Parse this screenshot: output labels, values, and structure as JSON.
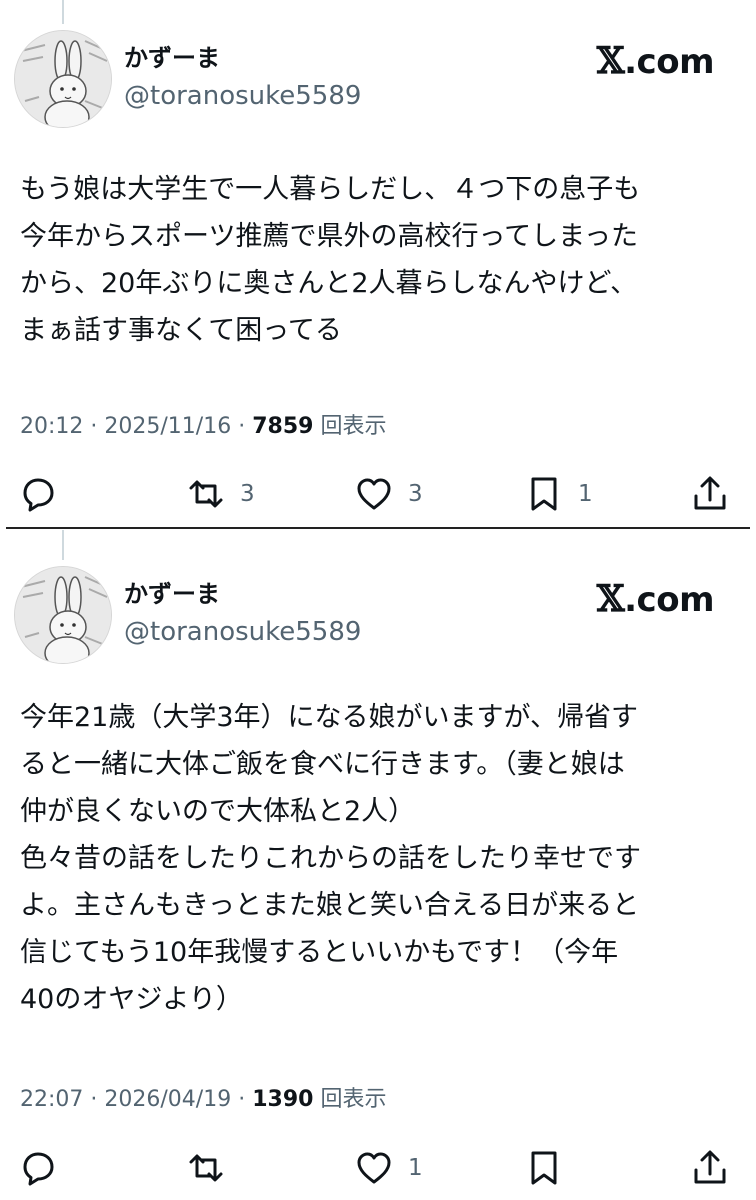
{
  "tweets": [
    {
      "display_name": "かずーま",
      "handle": "@toranosuke5589",
      "brand": ".com",
      "text": "もう娘は大学生で一人暮らしだし、４つ下の息子も\n今年からスポーツ推薦で県外の高校行ってしまった\nから、20年ぶりに奥さんと2人暮らしなんやけど、\nまぁ話す事なくて困ってる",
      "time": "20:12",
      "date": "2025/11/16",
      "views": "7859",
      "views_label": "回表示",
      "retweets": "3",
      "likes": "3",
      "bookmarks": "1"
    },
    {
      "display_name": "かずーま",
      "handle": "@toranosuke5589",
      "brand": ".com",
      "text": "今年21歳（大学3年）になる娘がいますが、帰省す\nると一緒に大体ご飯を食べに行きます。（妻と娘は\n仲が良くないので大体私と2人）\n色々昔の話をしたりこれからの話をしたり幸せです\nよ。主さんもきっとまた娘と笑い合える日が来ると\n信じてもう10年我慢するといいかもです！（今年\n40のオヤジより）",
      "time": "22:07",
      "date": "2026/04/19",
      "views": "1390",
      "views_label": "回表示",
      "retweets": "",
      "likes": "1",
      "bookmarks": ""
    }
  ],
  "separator": "·",
  "icons": {
    "brand": "x-logo-icon",
    "reply": "reply-icon",
    "retweet": "retweet-icon",
    "like": "heart-icon",
    "bookmark": "bookmark-icon",
    "share": "share-icon",
    "avatar": "rabbit-avatar"
  },
  "colors": {
    "text": "#0f1419",
    "secondary": "#536471",
    "background": "#ffffff"
  }
}
